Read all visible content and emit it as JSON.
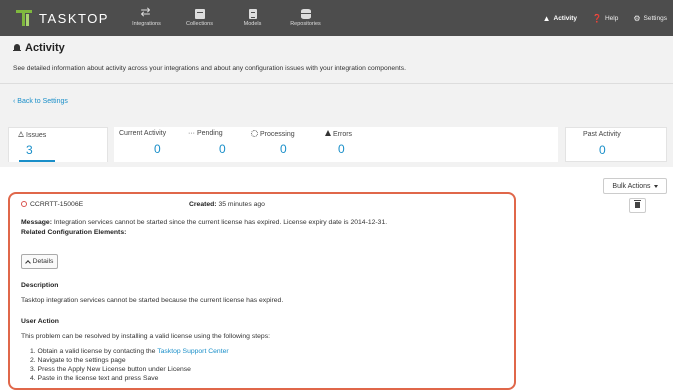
{
  "nav": {
    "logo_text": "TASKTOP",
    "items": [
      {
        "label": "Integrations",
        "icon": "arrows-icon"
      },
      {
        "label": "Collections",
        "icon": "collection-icon"
      },
      {
        "label": "Models",
        "icon": "model-icon"
      },
      {
        "label": "Repositories",
        "icon": "repository-icon"
      }
    ],
    "right": [
      {
        "label": "Activity",
        "icon": "bell-icon",
        "active": true
      },
      {
        "label": "Help",
        "icon": "help-icon"
      },
      {
        "label": "Settings",
        "icon": "gear-icon"
      }
    ]
  },
  "header": {
    "title": "Activity",
    "subtitle": "See detailed information about activity across your integrations and about any configuration issues with your integration components.",
    "back_link": "Back to Settings"
  },
  "stats": {
    "issues": {
      "label": "Issues",
      "value": "3"
    },
    "current": {
      "label": "Current Activity",
      "value": "0"
    },
    "pending": {
      "label": "Pending",
      "value": "0"
    },
    "processing": {
      "label": "Processing",
      "value": "0"
    },
    "errors": {
      "label": "Errors",
      "value": "0"
    },
    "past": {
      "label": "Past Activity",
      "value": "0"
    }
  },
  "bulk_actions_label": "Bulk Actions",
  "issue": {
    "id": "CCRRTT-15006E",
    "created_label": "Created:",
    "created_value": "35 minutes ago",
    "message_label": "Message:",
    "message_value": "Integration services cannot be started since the current license has expired. License expiry date is 2014-12-31.",
    "related_label": "Related Configuration Elements:",
    "details_label": "Details",
    "description_heading": "Description",
    "description_text": "Tasktop integration services cannot be started because the current license has expired.",
    "user_action_heading": "User Action",
    "user_action_intro": "This problem can be resolved by installing a valid license using the following steps:",
    "steps": [
      {
        "prefix": "1. Obtain a valid license by contacting the ",
        "link": "Tasktop Support Center"
      },
      {
        "prefix": "2. Navigate to the settings page",
        "link": ""
      },
      {
        "prefix": "3. Press the Apply New License button under License",
        "link": ""
      },
      {
        "prefix": "4. Paste in the license text and press Save",
        "link": ""
      }
    ]
  },
  "colors": {
    "nav_bg": "#4d4d4d",
    "accent": "#1a8fc9",
    "highlight_border": "#e0674a",
    "error": "#d9534f"
  }
}
